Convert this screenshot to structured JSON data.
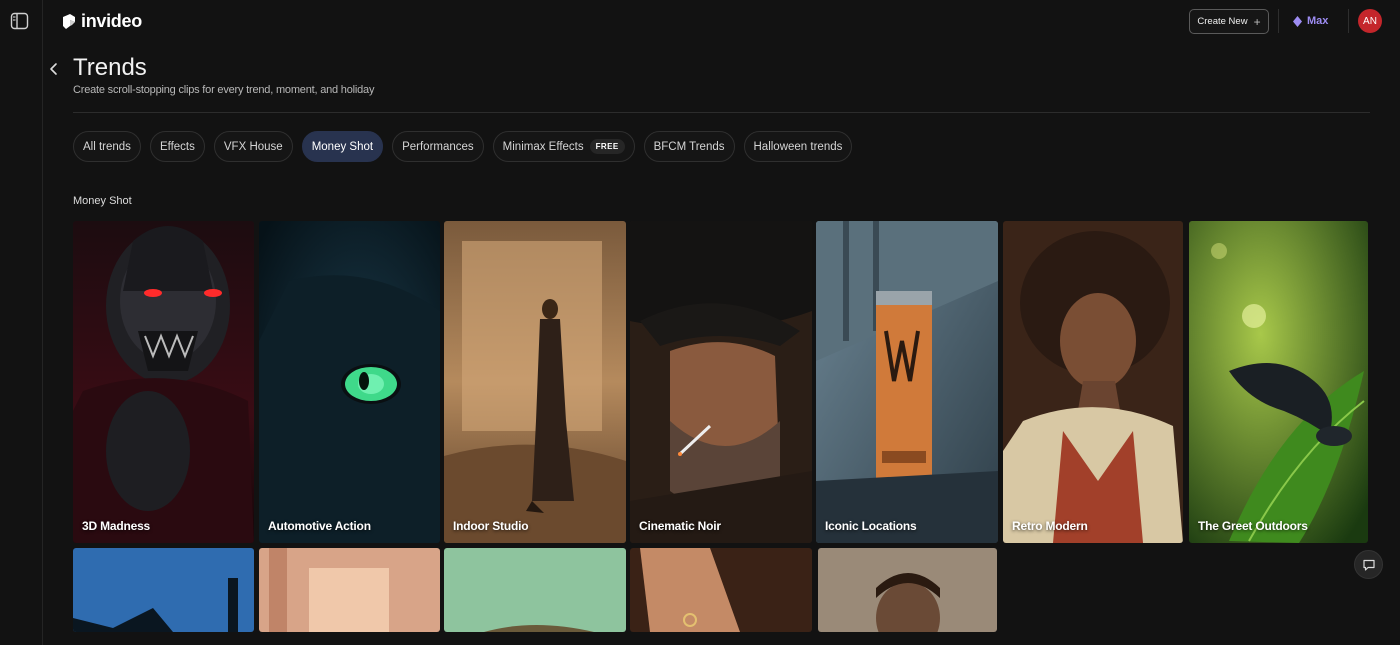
{
  "app": {
    "logo_text": "invideo",
    "create_new_label": "Create New",
    "plan_label": "Max",
    "avatar_initials": "AN",
    "colors": {
      "background": "#121212",
      "active_tab": "#28334f",
      "plan_accent": "#9d8cf2",
      "avatar_bg": "#c4262b"
    }
  },
  "header": {
    "title": "Trends",
    "subtitle": "Create scroll-stopping clips for every trend, moment, and holiday"
  },
  "tabs": [
    {
      "label": "All trends",
      "active": false
    },
    {
      "label": "Effects",
      "active": false
    },
    {
      "label": "VFX House",
      "active": false
    },
    {
      "label": "Money Shot",
      "active": true
    },
    {
      "label": "Performances",
      "active": false
    },
    {
      "label": "Minimax Effects",
      "badge": "FREE",
      "active": false
    },
    {
      "label": "BFCM Trends",
      "active": false
    },
    {
      "label": "Halloween trends",
      "active": false
    }
  ],
  "section": {
    "title": "Money Shot",
    "cards": [
      {
        "label": "3D Madness"
      },
      {
        "label": "Automotive Action"
      },
      {
        "label": "Indoor Studio"
      },
      {
        "label": "Cinematic Noir"
      },
      {
        "label": "Iconic Locations"
      },
      {
        "label": "Retro Modern"
      },
      {
        "label": "The Greet Outdoors"
      }
    ],
    "second_row_count": 5
  },
  "icons": [
    "sidebar-toggle-icon",
    "logo-icon",
    "plus-icon",
    "diamond-icon",
    "back-arrow-icon",
    "chat-icon"
  ]
}
